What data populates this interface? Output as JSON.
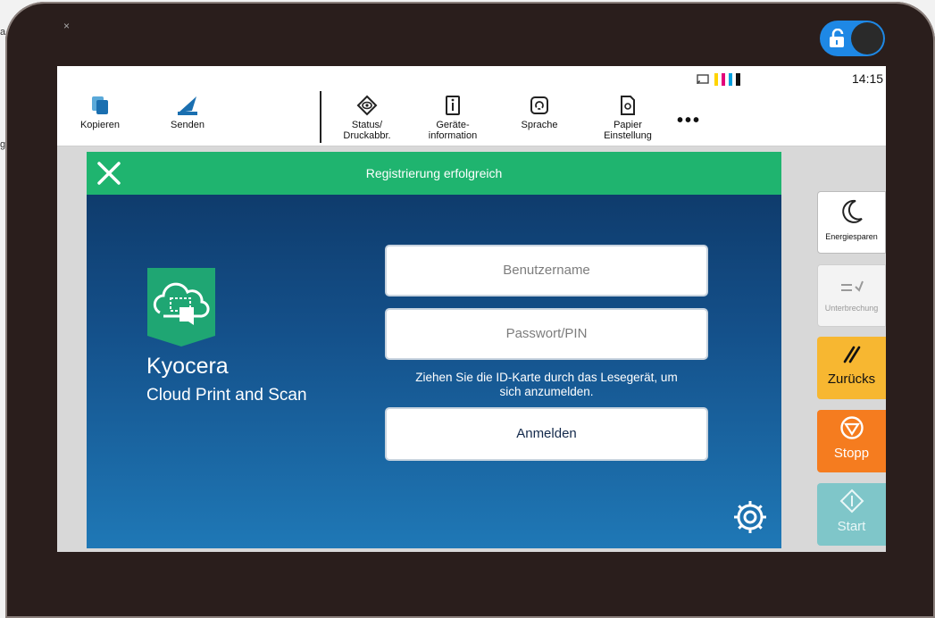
{
  "left_edge_fragments": [
    "a",
    "g"
  ],
  "bezel": {
    "mark": "×"
  },
  "status_bar": {
    "time": "14:15"
  },
  "toolbar": {
    "copy_label": "Kopieren",
    "send_label": "Senden",
    "status_label_1": "Status/",
    "status_label_2": "Druckabbr.",
    "device_label_1": "Geräte-",
    "device_label_2": "information",
    "language_label": "Sprache",
    "paper_label_1": "Papier",
    "paper_label_2": "Einstellung",
    "more_label": "•••"
  },
  "dialog": {
    "title": "Registrierung erfolgreich",
    "brand_name": "Kyocera",
    "brand_subtitle": "Cloud Print and Scan",
    "username_placeholder": "Benutzername",
    "password_placeholder": "Passwort/PIN",
    "hint_line1": "Ziehen Sie die ID-Karte durch das Lesegerät, um",
    "hint_line2": "sich anzumelden.",
    "login_label": "Anmelden"
  },
  "side_buttons": {
    "energy_label": "Energiesparen",
    "interrupt_label": "Unterbrechung",
    "reset_label": "Zurücks",
    "stop_label": "Stopp",
    "start_label": "Start"
  },
  "colors": {
    "header_green": "#1fb46f",
    "reset_yellow": "#f7b731",
    "stop_orange": "#f57c1f",
    "start_teal": "#7fc6c9",
    "toggle_blue": "#1e88e5"
  }
}
